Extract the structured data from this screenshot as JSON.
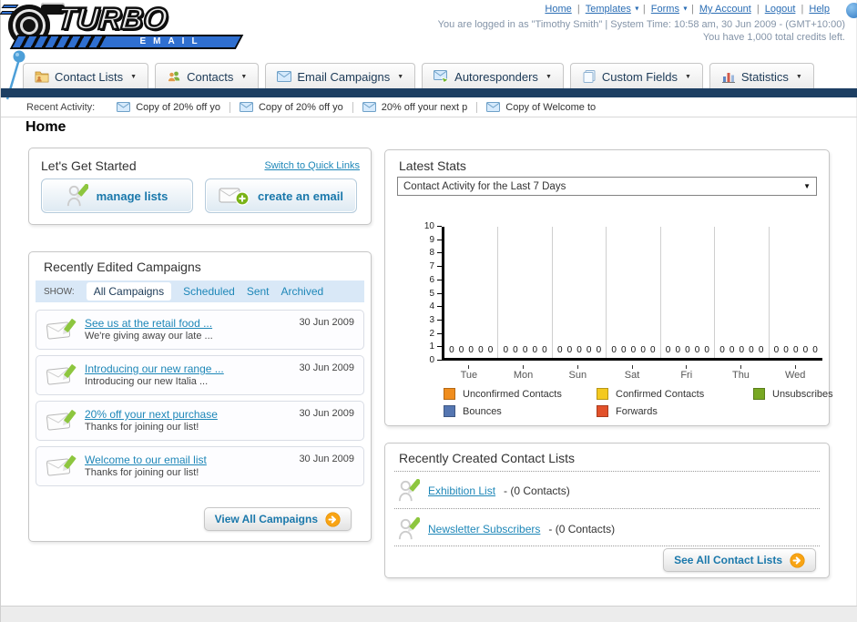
{
  "colors": {
    "navy_bar": "#1d3f63",
    "link_blue": "#2a6db4",
    "teal_link": "#1e87b8",
    "orange_arrow": "#f8a414"
  },
  "icons": {
    "dropdown_arrow": "▼"
  },
  "header": {
    "logo_title": "TURBO",
    "logo_subtitle": "EMAIL",
    "nav": [
      {
        "label": "Home",
        "dropdown": false
      },
      {
        "label": "Templates",
        "dropdown": true
      },
      {
        "label": "Forms",
        "dropdown": true
      },
      {
        "label": "My Account",
        "dropdown": false
      },
      {
        "label": "Logout",
        "dropdown": false
      },
      {
        "label": "Help",
        "dropdown": false
      }
    ],
    "login_line": "You are logged in as \"Timothy Smith\" | System Time: 10:58 am, 30 Jun 2009 - (GMT+10:00)",
    "credits_line": "You have 1,000 total credits left."
  },
  "tabs": [
    {
      "label": "Contact Lists"
    },
    {
      "label": "Contacts"
    },
    {
      "label": "Email Campaigns"
    },
    {
      "label": "Autoresponders"
    },
    {
      "label": "Custom Fields"
    },
    {
      "label": "Statistics"
    }
  ],
  "recent_activity": {
    "label": "Recent Activity:",
    "items": [
      "Copy of 20% off yo",
      "Copy of 20% off yo",
      "20% off your next p",
      "Copy of Welcome to"
    ]
  },
  "page_title": "Home",
  "get_started": {
    "title": "Let's Get Started",
    "switch_link": "Switch to Quick Links",
    "manage_lists_label": "manage lists",
    "create_email_label": "create an email"
  },
  "campaigns": {
    "title": "Recently Edited Campaigns",
    "show_label": "SHOW:",
    "filters": [
      "All Campaigns",
      "Scheduled",
      "Sent",
      "Archived"
    ],
    "active_filter": "All Campaigns",
    "view_all_label": "View All Campaigns",
    "items": [
      {
        "title": "See us at the retail food ...",
        "subtitle": "We're giving away our late ...",
        "date": "30 Jun 2009"
      },
      {
        "title": "Introducing our new range ...",
        "subtitle": "Introducing our new Italia ...",
        "date": "30 Jun 2009"
      },
      {
        "title": "20% off your next purchase",
        "subtitle": "Thanks for joining our list!",
        "date": "30 Jun 2009"
      },
      {
        "title": "Welcome to our email list",
        "subtitle": "Thanks for joining our list!",
        "date": "30 Jun 2009"
      }
    ]
  },
  "latest_stats": {
    "title": "Latest Stats",
    "selected_option": "Contact Activity for the Last 7 Days"
  },
  "chart_data": {
    "type": "bar",
    "title": "Contact Activity for the Last 7 Days",
    "categories": [
      "Tue",
      "Mon",
      "Sun",
      "Sat",
      "Fri",
      "Thu",
      "Wed"
    ],
    "series": [
      {
        "name": "Unconfirmed Contacts",
        "color": "#F08D1D",
        "values": [
          0,
          0,
          0,
          0,
          0,
          0,
          0
        ]
      },
      {
        "name": "Confirmed Contacts",
        "color": "#F4C91F",
        "values": [
          0,
          0,
          0,
          0,
          0,
          0,
          0
        ]
      },
      {
        "name": "Unsubscribes",
        "color": "#78A823",
        "values": [
          0,
          0,
          0,
          0,
          0,
          0,
          0
        ]
      },
      {
        "name": "Bounces",
        "color": "#5576B1",
        "values": [
          0,
          0,
          0,
          0,
          0,
          0,
          0
        ]
      },
      {
        "name": "Forwards",
        "color": "#E2512A",
        "values": [
          0,
          0,
          0,
          0,
          0,
          0,
          0
        ]
      }
    ],
    "ylim": [
      0,
      10
    ],
    "ytick_step": 1,
    "grid": "vertical-between-groups",
    "legend_position": "bottom",
    "value_labels_shown": true
  },
  "contact_lists": {
    "title": "Recently Created Contact Lists",
    "see_all_label": "See All Contact Lists",
    "items": [
      {
        "name": "Exhibition List",
        "count": "- (0 Contacts)"
      },
      {
        "name": "Newsletter Subscribers",
        "count": "- (0 Contacts)"
      }
    ]
  }
}
